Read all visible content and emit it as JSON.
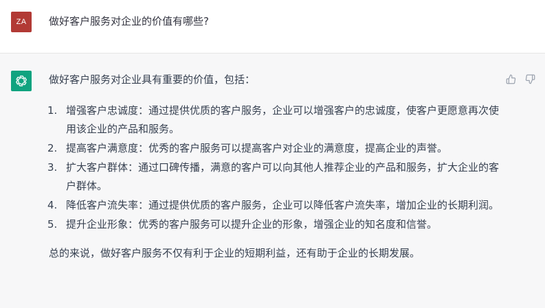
{
  "user": {
    "avatar_initials": "ZA",
    "avatar_color": "#b23a35",
    "message": "做好客户服务对企业的价值有哪些?"
  },
  "assistant": {
    "avatar_icon": "openai-logo-icon",
    "avatar_color": "#10a37f",
    "intro": "做好客户服务对企业具有重要的价值，包括：",
    "points": [
      {
        "num": "1.",
        "text": "增强客户忠诚度：通过提供优质的客户服务，企业可以增强客户的忠诚度，使客户更愿意再次使用该企业的产品和服务。"
      },
      {
        "num": "2.",
        "text": "提高客户满意度：优秀的客户服务可以提高客户对企业的满意度，提高企业的声誉。"
      },
      {
        "num": "3.",
        "text": "扩大客户群体：通过口碑传播，满意的客户可以向其他人推荐企业的产品和服务，扩大企业的客户群体。"
      },
      {
        "num": "4.",
        "text": "降低客户流失率：通过提供优质的客户服务，企业可以降低客户流失率，增加企业的长期利润。"
      },
      {
        "num": "5.",
        "text": "提升企业形象：优秀的客户服务可以提升企业的形象，增强企业的知名度和信誉。"
      }
    ],
    "summary": "总的来说，做好客户服务不仅有利于企业的短期利益，还有助于企业的长期发展。",
    "feedback": {
      "thumbs_up_icon": "thumbs-up-icon",
      "thumbs_down_icon": "thumbs-down-icon"
    }
  }
}
